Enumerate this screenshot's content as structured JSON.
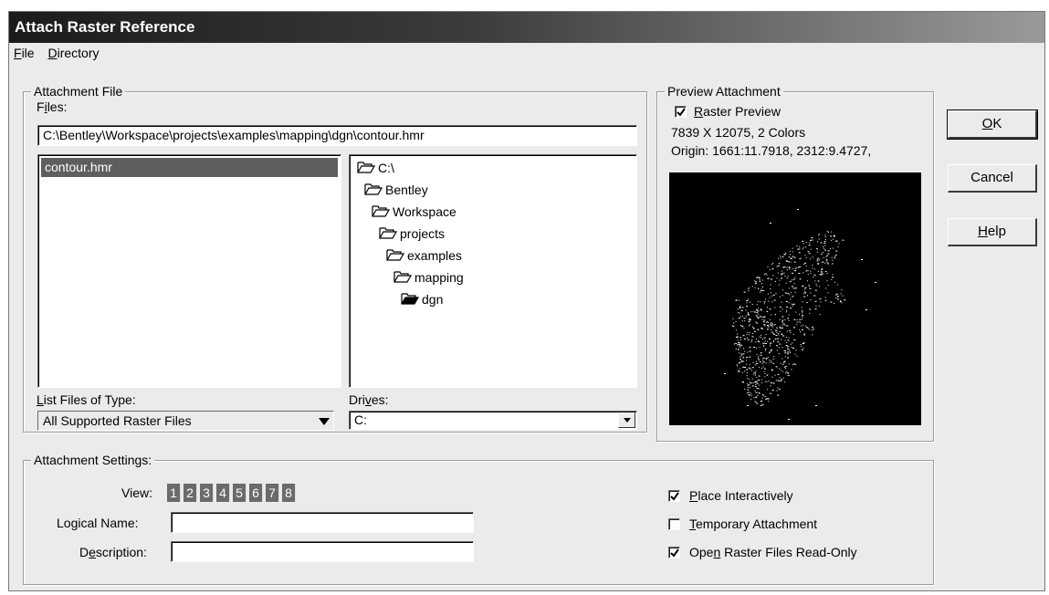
{
  "window": {
    "title": "Attach Raster Reference"
  },
  "menu": {
    "file_label": "File",
    "file_key": "F",
    "file_rest": "ile",
    "directory_label": "Directory",
    "directory_key": "D",
    "directory_rest": "irectory"
  },
  "attachment_file": {
    "legend": "Attachment File",
    "files_label_key": "i",
    "files_label_pre": "F",
    "files_label_post": "les:",
    "path_value": "C:\\Bentley\\Workspace\\projects\\examples\\mapping\\dgn\\contour.hmr",
    "file_list": [
      "contour.hmr"
    ],
    "directory_tree": [
      "C:\\",
      "Bentley",
      "Workspace",
      "projects",
      "examples",
      "mapping",
      "dgn"
    ],
    "list_type_label_key": "L",
    "list_type_label_rest": "ist Files of Type:",
    "list_type_value": "All Supported Raster Files",
    "drives_label_pre": "Dri",
    "drives_label_key": "v",
    "drives_label_post": "es:",
    "drives_value": "C:"
  },
  "preview": {
    "legend": "Preview Attachment",
    "raster_preview_key": "R",
    "raster_preview_rest": "aster Preview",
    "raster_preview_checked": true,
    "dimensions_text": "7839 X 12075, 2 Colors",
    "origin_text": "Origin: 1661:11.7918, 2312:9.4727,"
  },
  "buttons": {
    "ok_key": "O",
    "ok_rest": "K",
    "cancel_label": "Cancel",
    "help_key": "H",
    "help_rest": "elp"
  },
  "settings": {
    "legend": "Attachment Settings:",
    "view_label": "View:",
    "views": [
      "1",
      "2",
      "3",
      "4",
      "5",
      "6",
      "7",
      "8"
    ],
    "logical_name_pre": "Lo",
    "logical_name_key": "g",
    "logical_name_post": "ical Name:",
    "logical_name_value": "",
    "description_pre": "D",
    "description_key": "e",
    "description_post": "scription:",
    "description_value": "",
    "place_interactively_key": "P",
    "place_interactively_rest": "lace Interactively",
    "place_interactively_checked": true,
    "temporary_key": "T",
    "temporary_rest": "emporary Attachment",
    "temporary_checked": false,
    "readonly_pre": "Ope",
    "readonly_key": "n",
    "readonly_post": " Raster Files Read-Only",
    "readonly_checked": true
  },
  "colors": {
    "title_dark": "#1b1b1b",
    "selection": "#5e5e5e",
    "dialog_bg": "#ebebeb"
  }
}
